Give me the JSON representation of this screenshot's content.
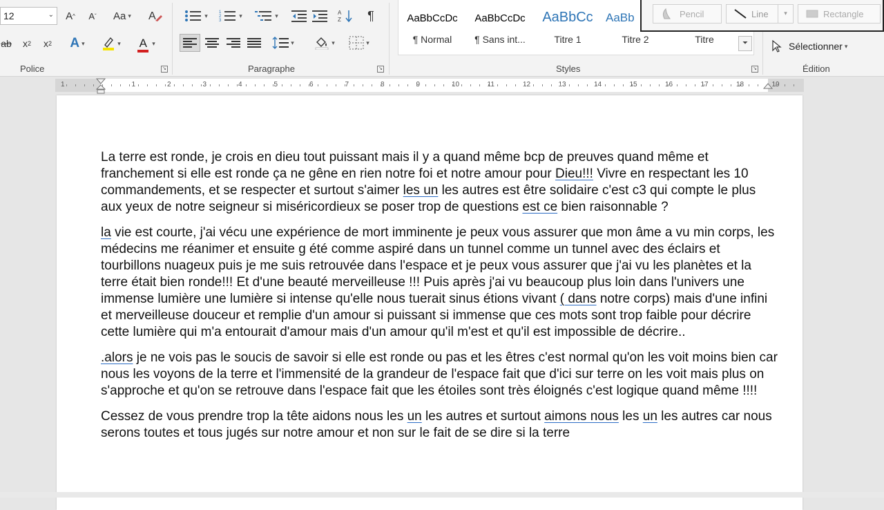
{
  "ribbon": {
    "font_size": "12",
    "groups": {
      "police": "Police",
      "paragraphe": "Paragraphe",
      "styles": "Styles",
      "edition": "Édition"
    },
    "styles": [
      {
        "sample": "AaBbCcDc",
        "name": "¶ Normal"
      },
      {
        "sample": "AaBbCcDc",
        "name": "¶ Sans int..."
      },
      {
        "sample": "AaBbCc",
        "name": "Titre 1"
      },
      {
        "sample": "AaBb",
        "name": "Titre 2"
      },
      {
        "sample": "",
        "name": "Titre"
      }
    ],
    "select_label": "Sélectionner",
    "draw_tools": {
      "pencil": "Pencil",
      "line": "Line",
      "rectangle": "Rectangle"
    },
    "colors": {
      "highlight": "#f5e400",
      "font_color": "#d21f1f",
      "text_effects": "#2e75b6"
    }
  },
  "ruler": {
    "labels": [
      "1",
      "1",
      "2",
      "3",
      "4",
      "5",
      "6",
      "7",
      "8",
      "9",
      "10",
      "11",
      "12",
      "13",
      "14",
      "15",
      "16",
      "17",
      "18",
      "19"
    ]
  },
  "document": {
    "paragraphs": [
      [
        {
          "t": "La terre est ronde, je crois en dieu tout puissant mais il y a quand même bcp de preuves quand même et franchement si elle est ronde ça ne gêne en rien notre foi et notre amour pour "
        },
        {
          "t": "Dieu!!!",
          "u": true
        },
        {
          "t": " Vivre en respectant les 10 commandements, et se respecter et surtout s'aimer "
        },
        {
          "t": "les un",
          "u": true
        },
        {
          "t": " les autres est être solidaire c'est c3 qui compte le plus aux yeux de notre seigneur si miséricordieux se poser trop de questions  "
        },
        {
          "t": "est ce",
          "u": true
        },
        {
          "t": " bien raisonnable ?"
        }
      ],
      [
        {
          "t": "la",
          "u": true
        },
        {
          "t": " vie est courte, j'ai vécu une expérience de mort imminente je peux vous assurer que mon âme a vu min corps, les médecins me réanimer et ensuite g été comme aspiré dans un tunnel comme un tunnel avec des éclairs et tourbillons nuageux puis je me suis retrouvée dans l'espace et je peux vous assurer que j'ai vu les planètes et la terre était bien ronde!!! Et d'une beauté merveilleuse !!! Puis après j'ai vu beaucoup plus loin dans l'univers une immense lumière une lumière si intense qu'elle nous tuerait sinus étions vivant "
        },
        {
          "t": "( dans",
          "u": true
        },
        {
          "t": " notre corps) mais d'une infini et merveilleuse douceur et remplie d'un amour si puissant si immense que ces mots sont trop faible pour décrire cette lumière qui m'a entourait d'amour mais d'un amour qu'il m'est et qu'il est impossible de décrire.."
        }
      ],
      [
        {
          "t": ".alors",
          "u": true
        },
        {
          "t": " je ne vois pas le soucis de savoir si elle est ronde ou pas et les êtres c'est normal qu'on les voit moins bien car nous les voyons de la terre et l'immensité de la grandeur de l'espace fait que d'ici sur terre on les voit mais plus on s'approche et qu'on se retrouve dans l'espace fait que les étoiles sont très éloignés c'est logique quand même !!!!"
        }
      ],
      [
        {
          "t": "Cessez de vous prendre trop la tête aidons nous les "
        },
        {
          "t": "un",
          "u": true
        },
        {
          "t": " les autres et surtout "
        },
        {
          "t": "aimons nous",
          "u": true
        },
        {
          "t": " les "
        },
        {
          "t": "un",
          "u": true
        },
        {
          "t": " les autres car nous serons toutes et tous jugés sur notre amour et non sur le fait de se dire si la terre"
        }
      ]
    ]
  }
}
